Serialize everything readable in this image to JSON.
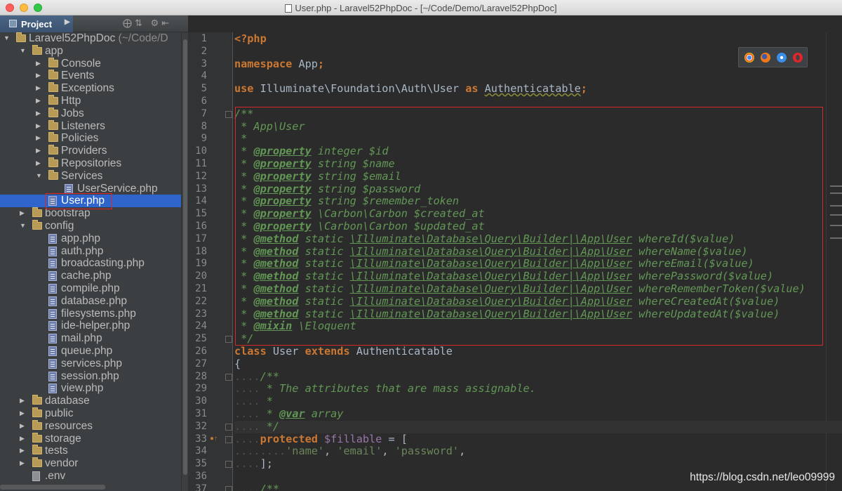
{
  "window": {
    "title": "User.php - Laravel52PhpDoc - [~/Code/Demo/Laravel52PhpDoc]"
  },
  "project_panel": {
    "tab_label": "Project",
    "tree": [
      {
        "label": "Laravel52PhpDoc",
        "suffix": " (~/Code/D",
        "type": "folder",
        "depth": 0,
        "expanded": true
      },
      {
        "label": "app",
        "type": "folder",
        "depth": 1,
        "expanded": true
      },
      {
        "label": "Console",
        "type": "folder",
        "depth": 2,
        "expanded": false
      },
      {
        "label": "Events",
        "type": "folder",
        "depth": 2,
        "expanded": false
      },
      {
        "label": "Exceptions",
        "type": "folder",
        "depth": 2,
        "expanded": false
      },
      {
        "label": "Http",
        "type": "folder",
        "depth": 2,
        "expanded": false
      },
      {
        "label": "Jobs",
        "type": "folder",
        "depth": 2,
        "expanded": false
      },
      {
        "label": "Listeners",
        "type": "folder",
        "depth": 2,
        "expanded": false
      },
      {
        "label": "Policies",
        "type": "folder",
        "depth": 2,
        "expanded": false
      },
      {
        "label": "Providers",
        "type": "folder",
        "depth": 2,
        "expanded": false
      },
      {
        "label": "Repositories",
        "type": "folder",
        "depth": 2,
        "expanded": false
      },
      {
        "label": "Services",
        "type": "folder",
        "depth": 2,
        "expanded": true
      },
      {
        "label": "UserService.php",
        "type": "php",
        "depth": 3
      },
      {
        "label": "User.php",
        "type": "php",
        "depth": 2,
        "selected": true
      },
      {
        "label": "bootstrap",
        "type": "folder",
        "depth": 1,
        "expanded": false
      },
      {
        "label": "config",
        "type": "folder",
        "depth": 1,
        "expanded": true
      },
      {
        "label": "app.php",
        "type": "php",
        "depth": 2
      },
      {
        "label": "auth.php",
        "type": "php",
        "depth": 2
      },
      {
        "label": "broadcasting.php",
        "type": "php",
        "depth": 2
      },
      {
        "label": "cache.php",
        "type": "php",
        "depth": 2
      },
      {
        "label": "compile.php",
        "type": "php",
        "depth": 2
      },
      {
        "label": "database.php",
        "type": "php",
        "depth": 2
      },
      {
        "label": "filesystems.php",
        "type": "php",
        "depth": 2
      },
      {
        "label": "ide-helper.php",
        "type": "php",
        "depth": 2
      },
      {
        "label": "mail.php",
        "type": "php",
        "depth": 2
      },
      {
        "label": "queue.php",
        "type": "php",
        "depth": 2
      },
      {
        "label": "services.php",
        "type": "php",
        "depth": 2
      },
      {
        "label": "session.php",
        "type": "php",
        "depth": 2
      },
      {
        "label": "view.php",
        "type": "php",
        "depth": 2
      },
      {
        "label": "database",
        "type": "folder",
        "depth": 1,
        "expanded": false
      },
      {
        "label": "public",
        "type": "folder",
        "depth": 1,
        "expanded": false
      },
      {
        "label": "resources",
        "type": "folder",
        "depth": 1,
        "expanded": false
      },
      {
        "label": "storage",
        "type": "folder",
        "depth": 1,
        "expanded": false
      },
      {
        "label": "tests",
        "type": "folder",
        "depth": 1,
        "expanded": false
      },
      {
        "label": "vendor",
        "type": "folder",
        "depth": 1,
        "expanded": false
      },
      {
        "label": ".env",
        "type": "plain",
        "depth": 1
      }
    ]
  },
  "editor": {
    "current_line": 32,
    "lines": [
      [
        [
          "kw",
          "<?php"
        ]
      ],
      [],
      [
        [
          "kw",
          "namespace "
        ],
        [
          "t",
          "App"
        ],
        [
          "kw",
          ";"
        ]
      ],
      [],
      [
        [
          "kw",
          "use "
        ],
        [
          "t",
          "Illuminate\\Foundation\\Auth\\User "
        ],
        [
          "kw",
          "as "
        ],
        [
          "u",
          "Authenticatable"
        ],
        [
          "kw",
          ";"
        ]
      ],
      [],
      [
        [
          "doc",
          "/**"
        ]
      ],
      [
        [
          "doc",
          " * App\\User"
        ]
      ],
      [
        [
          "doc",
          " *"
        ]
      ],
      [
        [
          "doc",
          " * "
        ],
        [
          "tag",
          "@property"
        ],
        [
          "doc",
          " integer $id"
        ]
      ],
      [
        [
          "doc",
          " * "
        ],
        [
          "tag",
          "@property"
        ],
        [
          "doc",
          " string $name"
        ]
      ],
      [
        [
          "doc",
          " * "
        ],
        [
          "tag",
          "@property"
        ],
        [
          "doc",
          " string $email"
        ]
      ],
      [
        [
          "doc",
          " * "
        ],
        [
          "tag",
          "@property"
        ],
        [
          "doc",
          " string $password"
        ]
      ],
      [
        [
          "doc",
          " * "
        ],
        [
          "tag",
          "@property"
        ],
        [
          "doc",
          " string $remember_token"
        ]
      ],
      [
        [
          "doc",
          " * "
        ],
        [
          "tag",
          "@property"
        ],
        [
          "doc",
          " \\Carbon\\Carbon $created_at"
        ]
      ],
      [
        [
          "doc",
          " * "
        ],
        [
          "tag",
          "@property"
        ],
        [
          "doc",
          " \\Carbon\\Carbon $updated_at"
        ]
      ],
      [
        [
          "doc",
          " * "
        ],
        [
          "tag",
          "@method"
        ],
        [
          "doc",
          " static "
        ],
        [
          "dl",
          "\\Illuminate\\Database\\Query\\Builder|\\App\\User"
        ],
        [
          "doc",
          " whereId($value)"
        ]
      ],
      [
        [
          "doc",
          " * "
        ],
        [
          "tag",
          "@method"
        ],
        [
          "doc",
          " static "
        ],
        [
          "dl",
          "\\Illuminate\\Database\\Query\\Builder|\\App\\User"
        ],
        [
          "doc",
          " whereName($value)"
        ]
      ],
      [
        [
          "doc",
          " * "
        ],
        [
          "tag",
          "@method"
        ],
        [
          "doc",
          " static "
        ],
        [
          "dl",
          "\\Illuminate\\Database\\Query\\Builder|\\App\\User"
        ],
        [
          "doc",
          " whereEmail($value)"
        ]
      ],
      [
        [
          "doc",
          " * "
        ],
        [
          "tag",
          "@method"
        ],
        [
          "doc",
          " static "
        ],
        [
          "dl",
          "\\Illuminate\\Database\\Query\\Builder|\\App\\User"
        ],
        [
          "doc",
          " wherePassword($value)"
        ]
      ],
      [
        [
          "doc",
          " * "
        ],
        [
          "tag",
          "@method"
        ],
        [
          "doc",
          " static "
        ],
        [
          "dl",
          "\\Illuminate\\Database\\Query\\Builder|\\App\\User"
        ],
        [
          "doc",
          " whereRememberToken($value)"
        ]
      ],
      [
        [
          "doc",
          " * "
        ],
        [
          "tag",
          "@method"
        ],
        [
          "doc",
          " static "
        ],
        [
          "dl",
          "\\Illuminate\\Database\\Query\\Builder|\\App\\User"
        ],
        [
          "doc",
          " whereCreatedAt($value)"
        ]
      ],
      [
        [
          "doc",
          " * "
        ],
        [
          "tag",
          "@method"
        ],
        [
          "doc",
          " static "
        ],
        [
          "dl",
          "\\Illuminate\\Database\\Query\\Builder|\\App\\User"
        ],
        [
          "doc",
          " whereUpdatedAt($value)"
        ]
      ],
      [
        [
          "doc",
          " * "
        ],
        [
          "tag",
          "@mixin"
        ],
        [
          "doc",
          " \\Eloquent"
        ]
      ],
      [
        [
          "doc",
          " */"
        ]
      ],
      [
        [
          "kw",
          "class "
        ],
        [
          "t",
          "User "
        ],
        [
          "kw",
          "extends "
        ],
        [
          "t",
          "Authenticatable"
        ]
      ],
      [
        [
          "t",
          "{"
        ]
      ],
      [
        [
          "dim",
          "...."
        ],
        [
          "doc",
          "/**"
        ]
      ],
      [
        [
          "dim",
          "...."
        ],
        [
          "doc",
          " * The attributes that are mass assignable."
        ]
      ],
      [
        [
          "dim",
          "...."
        ],
        [
          "doc",
          " *"
        ]
      ],
      [
        [
          "dim",
          "...."
        ],
        [
          "doc",
          " * "
        ],
        [
          "tag",
          "@var"
        ],
        [
          "doc",
          " array"
        ]
      ],
      [
        [
          "dim",
          "...."
        ],
        [
          "doc",
          " */"
        ]
      ],
      [
        [
          "dim",
          "...."
        ],
        [
          "kw",
          "protected "
        ],
        [
          "var",
          "$fillable"
        ],
        [
          "t",
          " = ["
        ]
      ],
      [
        [
          "dim",
          "........"
        ],
        [
          "str",
          "'name'"
        ],
        [
          "t",
          ", "
        ],
        [
          "str",
          "'email'"
        ],
        [
          "t",
          ", "
        ],
        [
          "str",
          "'password'"
        ],
        [
          "t",
          ","
        ]
      ],
      [
        [
          "dim",
          "...."
        ],
        [
          "t",
          "];"
        ]
      ],
      [],
      [
        [
          "dim",
          "...."
        ],
        [
          "doc",
          "/**"
        ]
      ]
    ]
  },
  "browsers": [
    "chrome-icon",
    "firefox-icon",
    "safari-icon",
    "opera-icon"
  ],
  "watermark": "https://blog.csdn.net/leo09999"
}
